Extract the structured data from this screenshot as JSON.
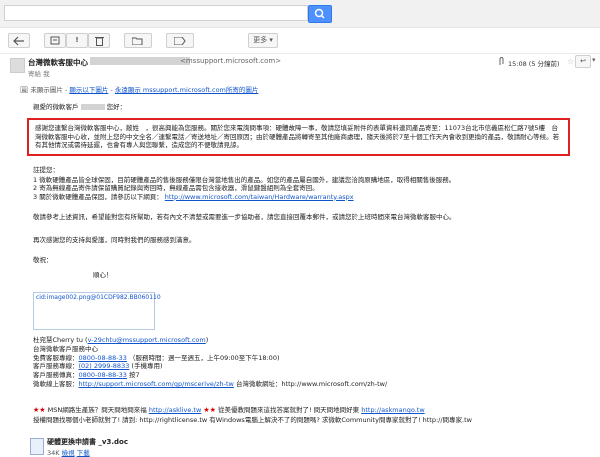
{
  "toolbar": {
    "more_label": "更多",
    "page_count": "15:08 (5 分鐘前)"
  },
  "header": {
    "sender_name": "台灣微軟客服中心",
    "sender_email": "<mssupport.microsoft.com>",
    "recipient": "寄給 我",
    "timestamp": "15:08 (5 分鐘前)"
  },
  "images_notice": {
    "text": "未顯示圖片",
    "link_show": "顯示以下圖片",
    "link_always": "永遠顯示 mssupport.microsoft.com所寄的圖片"
  },
  "email": {
    "greeting": "親愛的微軟客戶",
    "greeting_suffix": "您好：",
    "notice": "感謝您連繫台灣微軟客服中心，敝姓　，很高興能為您服務。關於您來電詢問事項：硬體故障一事，敬請您填妥附件的表單資料連同產品寄至：11073台北市信義區松仁路7號5樓　台灣微軟客服中心收，並附上您的中文全名／連繫電話／寄送地址／寄回原因；由於硬體產品將轉寄至其他廠商處理，隨天後將於7至十個工作天內會收到更換的產品，敬請耐心等候。若有其他情況或需待延遲，也會有專人與您聯繫，造成您的不便敬請見諒。",
    "reminder_title": "註提您：",
    "reminders": [
      "1 微軟硬體產品皆全球保固，目前硬體產品的售後服務僅限台灣當地售出的產品。如您的產品屬自國外，建議您洽詢原購地區，取得相關售後服務。",
      "2 寄為無線產品寄件請保留購買紀錄與寄回時，無線產品需包含接收器，滑鼠鍵盤組則為全套寄回。",
      "3 關於微軟硬體產品保固，請參訪以下網頁："
    ],
    "warranty_link": "http://www.microsoft.com/taiwan/Hardware/warranty.aspx",
    "p1": "敬請參考上述資訊，希望能對您有所幫助，若有內文不清楚或需要進一步協助者，請您直接回覆本郵件，或請您於上班時間來電台灣微軟客服中心。",
    "p2": "再次感謝您的支持與愛護，同時對我們的服務感到滿意。",
    "closing": "敬祝：",
    "wish": "順心！",
    "image_alt": "cid:image002.png@01CDF982.BB060110",
    "sig_name": "杜宛慧Cherry tu",
    "sig_email": "v-29chtu@mssupport.microsoft.com",
    "sig_center": "台灣微軟客戶服務中心",
    "sig_rows": [
      {
        "label": "免費客服專線：",
        "value": "0800-08-88-33",
        "extra": "（服務時間：週一至週五，上午09:00至下午18:00)"
      },
      {
        "label": "客戶服務專線：",
        "value": "(02) 2999-8833",
        "extra": "(手機專用)"
      },
      {
        "label": "客戶服務傳真：",
        "value": "0800-08-88-33",
        "extra": "按7"
      },
      {
        "label": "微軟線上客服：",
        "value": "http://support.microsoft.com/gp/mscerive/zh-tw",
        "extra": "台灣微軟網址：http://www.microsoft.com/zh-tw/"
      }
    ],
    "promo1_a": "MSN網路生產族？問天問地問來福",
    "promo1_a_link": "http://asklive.tw",
    "promo1_b": "從美優教問題來這找答案就對了! 問天問地問好東",
    "promo1_b_link": "http://askmango.tw",
    "promo2": "授權問題找哪個小老師就對了! 請到: http://rightlicense.tw 有Windows電腦上解決不了的問題嗎? 求微軟Community問專家就對了! http://問專家.tw"
  },
  "attachment": {
    "name": "硬體更換申請書 _v3.doc",
    "size": "34K",
    "view": "檢視",
    "download": "下載"
  }
}
